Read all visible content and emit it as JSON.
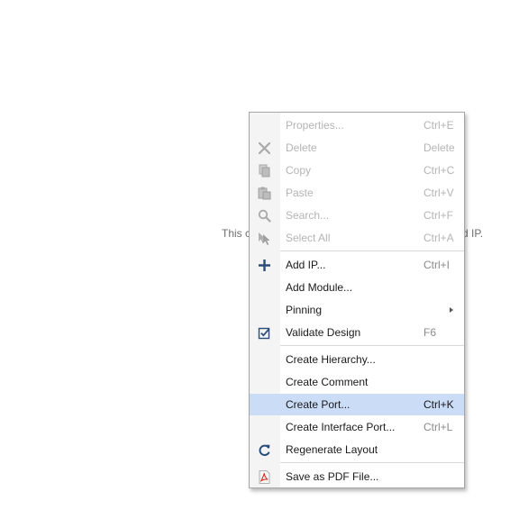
{
  "background": {
    "text_left": "This c",
    "text_right": "d IP."
  },
  "menu": {
    "items": [
      {
        "label": "Properties...",
        "shortcut": "Ctrl+E",
        "icon": "none",
        "disabled": true
      },
      {
        "label": "Delete",
        "shortcut": "Delete",
        "icon": "x-icon",
        "disabled": true
      },
      {
        "label": "Copy",
        "shortcut": "Ctrl+C",
        "icon": "copy-icon",
        "disabled": true
      },
      {
        "label": "Paste",
        "shortcut": "Ctrl+V",
        "icon": "paste-icon",
        "disabled": true
      },
      {
        "label": "Search...",
        "shortcut": "Ctrl+F",
        "icon": "search-icon",
        "disabled": true
      },
      {
        "label": "Select All",
        "shortcut": "Ctrl+A",
        "icon": "select-all-icon",
        "disabled": true
      },
      {
        "label": "Add IP...",
        "shortcut": "Ctrl+I",
        "icon": "plus-icon",
        "disabled": false
      },
      {
        "label": "Add Module...",
        "shortcut": "",
        "icon": "none",
        "disabled": false
      },
      {
        "label": "Pinning",
        "shortcut": "",
        "icon": "none",
        "disabled": false,
        "submenu": true
      },
      {
        "label": "Validate Design",
        "shortcut": "F6",
        "icon": "validate-checkbox-icon",
        "disabled": false
      },
      {
        "label": "Create Hierarchy...",
        "shortcut": "",
        "icon": "none",
        "disabled": false
      },
      {
        "label": "Create Comment",
        "shortcut": "",
        "icon": "none",
        "disabled": false
      },
      {
        "label": "Create Port...",
        "shortcut": "Ctrl+K",
        "icon": "none",
        "disabled": false,
        "hover": true
      },
      {
        "label": "Create Interface Port...",
        "shortcut": "Ctrl+L",
        "icon": "none",
        "disabled": false
      },
      {
        "label": "Regenerate Layout",
        "shortcut": "",
        "icon": "refresh-icon",
        "disabled": false
      },
      {
        "label": "Save as PDF File...",
        "shortcut": "",
        "icon": "pdf-icon",
        "disabled": false
      }
    ]
  },
  "colors": {
    "hover_background": "#cbdcf7",
    "disabled_text": "#b4b4b4",
    "icon_blue": "#2c4d7a",
    "pdf_red": "#d33c2c"
  }
}
